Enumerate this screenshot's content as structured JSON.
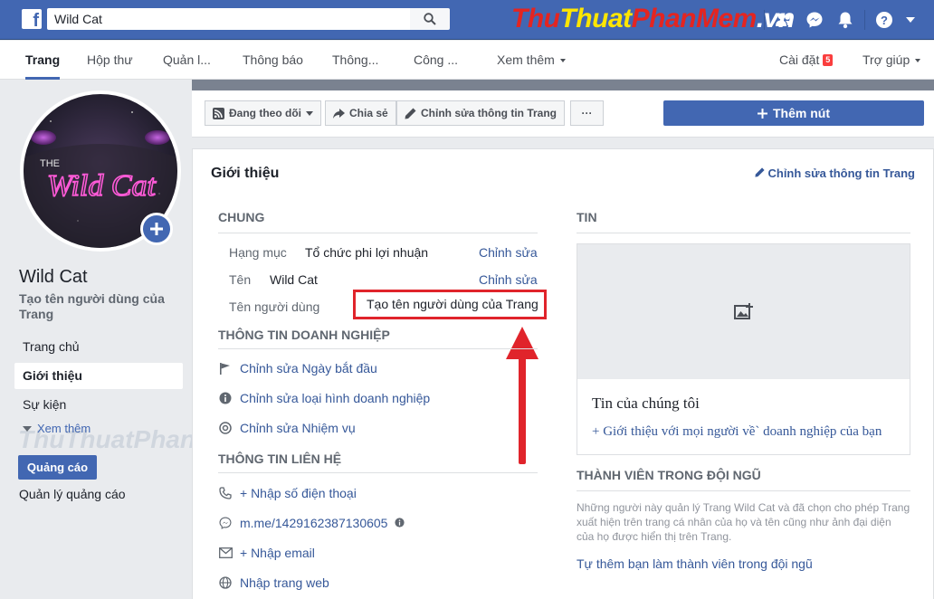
{
  "topbar": {
    "logo": "f",
    "search_value": "Wild Cat",
    "watermark": {
      "part1": "Thu",
      "part2": "Thuat",
      "part3": "PhanMem",
      "part4": ".vn"
    }
  },
  "nav": {
    "tabs": [
      "Trang",
      "Hộp thư",
      "Quản l...",
      "Thông báo",
      "Thông...",
      "Công ...",
      "Xem thêm"
    ],
    "settings": "Cài đặt",
    "settings_badge": "5",
    "help": "Trợ giúp"
  },
  "sidebar": {
    "avatar_text": "Wild Cat",
    "avatar_small": "THE",
    "page_name": "Wild Cat",
    "username_prompt": "Tạo tên người dùng của Trang",
    "items": [
      "Trang chủ",
      "Giới thiệu",
      "Sự kiện"
    ],
    "see_more": "Xem thêm",
    "ads_button": "Quảng cáo",
    "manage_ads": "Quản lý quảng cáo",
    "watermark": "ThuThuatPhanMem.vn"
  },
  "actions": {
    "follow": "Đang theo dõi",
    "share": "Chia sẻ",
    "edit_info": "Chỉnh sửa thông tin Trang",
    "more": "···",
    "add_button": "Thêm nút"
  },
  "about": {
    "title": "Giới thiệu",
    "edit_link": "Chỉnh sửa thông tin Trang",
    "general_header": "CHUNG",
    "rows": [
      {
        "label": "Hạng mục",
        "value": "Tổ chức phi lợi nhuận",
        "edit": "Chỉnh sửa"
      },
      {
        "label": "Tên",
        "value": "Wild Cat",
        "edit": "Chỉnh sửa"
      },
      {
        "label": "Tên người dùng",
        "value": "Tạo tên người dùng của Trang"
      }
    ],
    "business_header": "THÔNG TIN DOANH NGHIỆP",
    "business_items": [
      "Chỉnh sửa Ngày bắt đầu",
      "Chỉnh sửa loại hình doanh nghiệp",
      "Chỉnh sửa Nhiệm vụ"
    ],
    "contact_header": "THÔNG TIN LIÊN HỆ",
    "contact_items": [
      "+ Nhập số điện thoại",
      "m.me/1429162387130605",
      "+ Nhập email",
      "Nhập trang web"
    ]
  },
  "story": {
    "header": "TIN",
    "title": "Tin của chúng tôi",
    "link": "+ Giới thiệu với mọi người về` doanh nghiệp của bạn"
  },
  "team": {
    "header": "THÀNH VIÊN TRONG ĐỘI NGŨ",
    "description": "Những người này quản lý Trang Wild Cat và đã chọn cho phép Trang xuất hiện trên trang cá nhân của họ và tên cũng như ảnh đại diện của họ được hiển thị trên Trang.",
    "link": "Tự thêm bạn làm thành viên trong đội ngũ"
  },
  "colors": {
    "brand": "#4267b2",
    "highlight": "#e0242b",
    "link": "#365899"
  }
}
